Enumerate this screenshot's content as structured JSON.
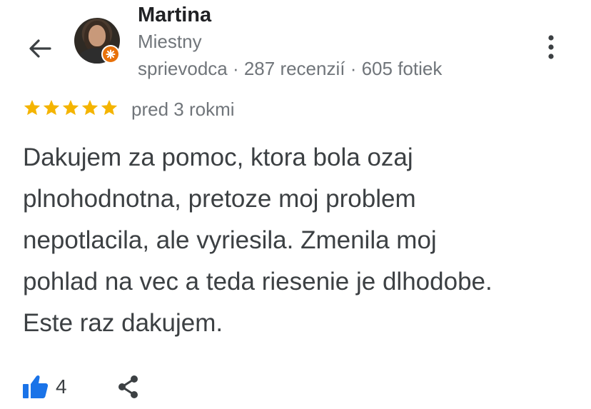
{
  "header": {
    "back_icon": "arrow-left-icon",
    "reviewer_name": "Martina",
    "reviewer_title": "Miestny",
    "reviewer_stats": "sprievodca · 287 recenzií · 605 fotiek",
    "badge_icon": "local-guide-badge-icon",
    "badge_color": "#e8710a",
    "more_icon": "more-vert-icon"
  },
  "rating": {
    "stars": 5,
    "max_stars": 5,
    "star_color": "#f4b400",
    "time_ago": "pred 3 rokmi"
  },
  "review": {
    "text": "Dakujem za pomoc, ktora bola ozaj\nplnohodnotna, pretoze moj problem\nnepotlacila, ale vyriesila. Zmenila moj\npohlad na vec a teda riesenie je dlhodobe.\nEste raz dakujem."
  },
  "actions": {
    "like_icon": "thumb-up-icon",
    "like_color": "#1a73e8",
    "like_count": "4",
    "share_icon": "share-icon"
  }
}
